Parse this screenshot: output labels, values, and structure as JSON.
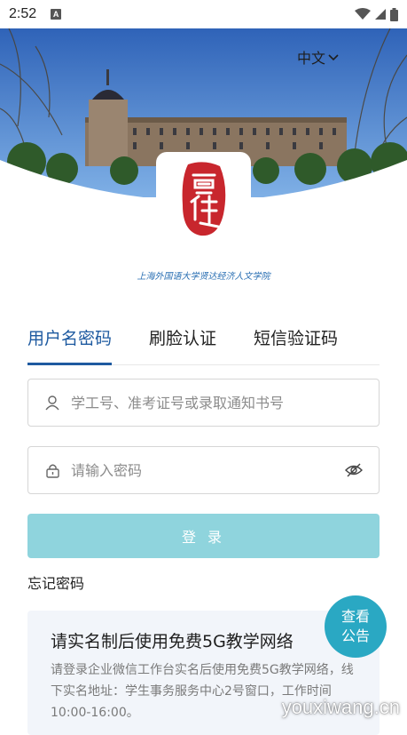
{
  "status_bar": {
    "time": "2:52",
    "notification_icon": "A"
  },
  "header": {
    "language": "中文"
  },
  "school": {
    "name": "上海外国语大学贤达经济人文学院"
  },
  "tabs": [
    {
      "label": "用户名密码",
      "active": true
    },
    {
      "label": "刷脸认证",
      "active": false
    },
    {
      "label": "短信验证码",
      "active": false
    }
  ],
  "form": {
    "username_placeholder": "学工号、准考证号或录取通知书号",
    "password_placeholder": "请输入密码",
    "login_label": "登 录",
    "forgot_label": "忘记密码"
  },
  "notice": {
    "title": "请实名制后使用免费5G教学网络",
    "body": "请登录企业微信工作台实名后使用免费5G教学网络，线下实名地址：学生事务服务中心2号窗口，工作时间10:00-16:00。"
  },
  "announce_button": {
    "line1": "查看",
    "line2": "公告"
  },
  "watermark": "youxiwang.cn",
  "colors": {
    "primary": "#1e5aa0",
    "login_button": "#8fd4dd",
    "announce_button": "#2aa8c3",
    "notice_bg": "#f2f5fa",
    "seal_red": "#c8262d"
  }
}
